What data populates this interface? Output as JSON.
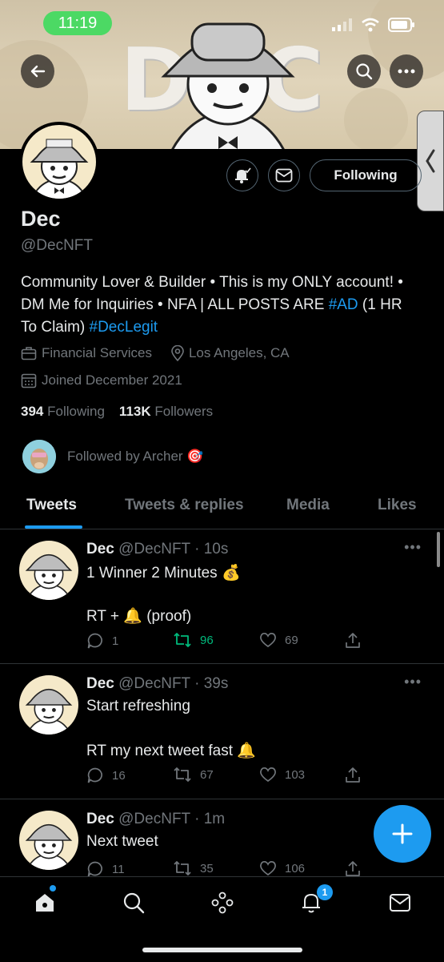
{
  "status_bar": {
    "time": "11:19"
  },
  "banner": {
    "word": "DEC"
  },
  "profile": {
    "name": "Dec",
    "handle": "@DecNFT",
    "follow_label": "Following",
    "bio_part1": "Community Lover & Builder • This is my ONLY account! • DM Me for Inquiries • NFA | ALL POSTS ARE ",
    "bio_link1": "#AD",
    "bio_part2": " (1 HR To Claim) ",
    "bio_link2": "#DecLegit",
    "category": "Financial Services",
    "location": "Los Angeles, CA",
    "joined": "Joined December 2021",
    "following_count": "394",
    "following_label": "Following",
    "followers_count": "113K",
    "followers_label": "Followers",
    "followed_by": "Followed by Archer 🎯"
  },
  "tabs": [
    {
      "label": "Tweets"
    },
    {
      "label": "Tweets & replies"
    },
    {
      "label": "Media"
    },
    {
      "label": "Likes"
    }
  ],
  "tweets": [
    {
      "name": "Dec",
      "meta": "@DecNFT · 10s",
      "line1": "1 Winner 2 Minutes 💰",
      "line2": "RT + 🔔 (proof)",
      "replies": "1",
      "retweets": "96",
      "likes": "69",
      "retweeted": true
    },
    {
      "name": "Dec",
      "meta": "@DecNFT · 39s",
      "line1": "Start refreshing",
      "line2": "RT my next tweet fast 🔔",
      "replies": "16",
      "retweets": "67",
      "likes": "103",
      "retweeted": false
    },
    {
      "name": "Dec",
      "meta": "@DecNFT · 1m",
      "line1": "Next tweet",
      "line2": "",
      "replies": "11",
      "retweets": "35",
      "likes": "106",
      "retweeted": false
    }
  ],
  "nav": {
    "notification_count": "1"
  },
  "colors": {
    "accent": "#1d9bf0",
    "retweet": "#00ba7c",
    "background": "#000000",
    "muted": "#71767b"
  }
}
